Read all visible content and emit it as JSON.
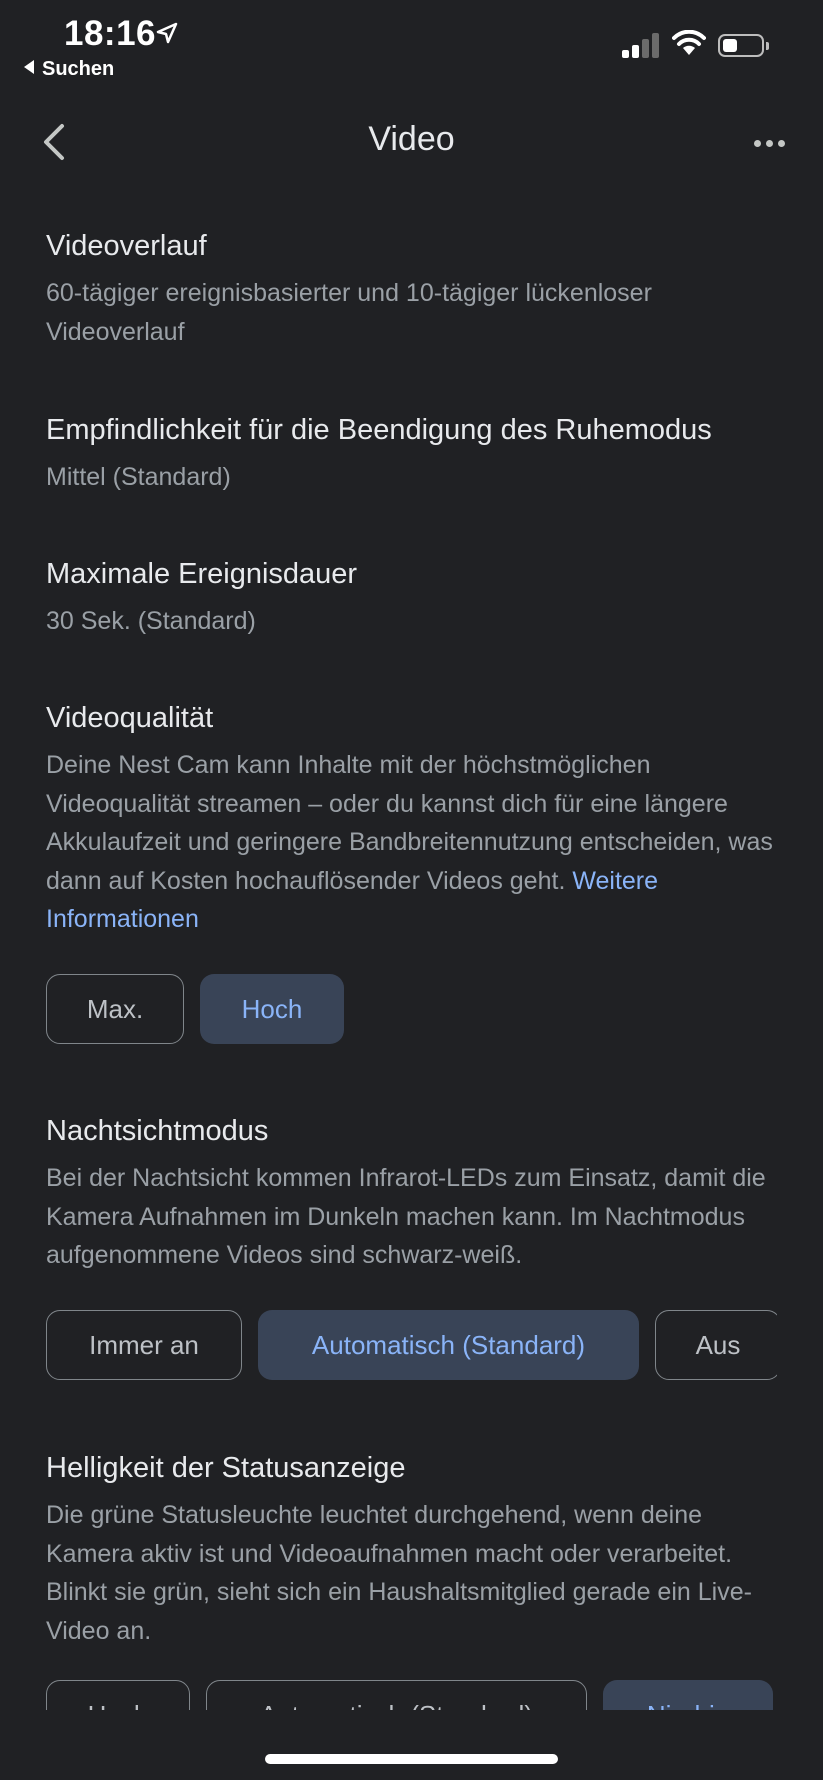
{
  "status_bar": {
    "time": "18:16",
    "back_app_label": "Suchen"
  },
  "header": {
    "title": "Video"
  },
  "sections": [
    {
      "title": "Videoverlauf",
      "subtitle": "60-tägiger ereignisbasierter und 10-tägiger lückenloser Videoverlauf"
    },
    {
      "title": "Empfindlichkeit für die Beendigung des Ruhemodus",
      "subtitle": "Mittel (Standard)"
    },
    {
      "title": "Maximale Ereignisdauer",
      "subtitle": "30 Sek. (Standard)"
    },
    {
      "title": "Videoqualität",
      "subtitle": "Deine Nest Cam kann Inhalte mit der höchstmöglichen Videoqualität streamen – oder du kannst dich für eine längere Akkulaufzeit und geringere Bandbreitennutzung entscheiden, was dann auf Kosten hochauflösender Videos geht.",
      "link": "Weitere Informationen",
      "options": [
        "Max.",
        "Hoch"
      ],
      "selected": "Hoch"
    },
    {
      "title": "Nachtsichtmodus",
      "subtitle": "Bei der Nachtsicht kommen Infrarot-LEDs zum Einsatz, damit die Kamera Aufnahmen im Dunkeln machen kann. Im Nachtmodus aufgenommene Videos sind schwarz-weiß.",
      "options": [
        "Immer an",
        "Automatisch (Standard)",
        "Aus"
      ],
      "selected": "Automatisch (Standard)"
    },
    {
      "title": "Helligkeit der Statusanzeige",
      "subtitle": "Die grüne Statusleuchte leuchtet durchgehend, wenn deine Kamera aktiv ist und Videoaufnahmen macht oder verarbeitet. Blinkt sie grün, sieht sich ein Haushaltsmitglied gerade ein Live-Video an.",
      "options": [
        "Hoch",
        "Automatisch (Standard)",
        "Niedrig"
      ],
      "selected": "Niedrig"
    }
  ],
  "colors": {
    "background": "#202124",
    "selected_chip": "#394457",
    "accent": "#8ab4f8"
  }
}
